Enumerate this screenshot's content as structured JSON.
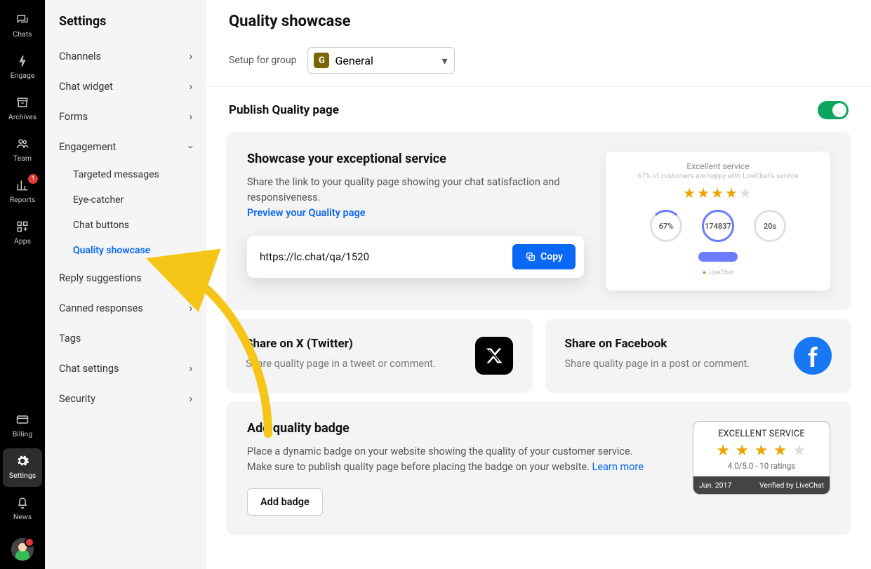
{
  "rail": {
    "chats": "Chats",
    "engage": "Engage",
    "archives": "Archives",
    "team": "Team",
    "reports": "Reports",
    "reports_badge": "1",
    "apps": "Apps",
    "billing": "Billing",
    "settings": "Settings",
    "news": "News"
  },
  "sidebar": {
    "title": "Settings",
    "channels": "Channels",
    "chat_widget": "Chat widget",
    "forms": "Forms",
    "engagement": "Engagement",
    "targeted_messages": "Targeted messages",
    "eye_catcher": "Eye-catcher",
    "chat_buttons": "Chat buttons",
    "quality_showcase": "Quality showcase",
    "reply_suggestions": "Reply suggestions",
    "canned_responses": "Canned responses",
    "tags": "Tags",
    "chat_settings": "Chat settings",
    "security": "Security"
  },
  "main": {
    "title": "Quality showcase",
    "setup_label": "Setup for group",
    "group_initial": "G",
    "group_name": "General",
    "publish_heading": "Publish Quality page",
    "showcase": {
      "heading": "Showcase your exceptional service",
      "desc": "Share the link to your quality page showing your chat satisfaction and responsiveness.",
      "preview_link": "Preview your Quality page",
      "url": "https://lc.chat/qa/1520",
      "copy": "Copy",
      "preview": {
        "title": "Excellent service",
        "subtitle": "67% of customers are happy with LiveChat's service",
        "c1": "67%",
        "c2": "174837",
        "c3": "20s",
        "footer": "LiveChat"
      }
    },
    "share_x": {
      "heading": "Share on X (Twitter)",
      "desc": "Share quality page in a tweet or comment."
    },
    "share_fb": {
      "heading": "Share on Facebook",
      "desc": "Share quality page in a post or comment."
    },
    "badge": {
      "heading": "Add quality badge",
      "desc1": "Place a dynamic badge on your website showing the quality of your customer service.",
      "desc2": "Make sure to publish quality page before placing the badge on your website. ",
      "learn_more": "Learn more",
      "add_btn": "Add badge",
      "widget": {
        "title": "EXCELLENT SERVICE",
        "rating": "4.0/5.0 - 10 ratings",
        "date": "Jun. 2017",
        "verified": "Verified by LiveChat"
      }
    }
  }
}
